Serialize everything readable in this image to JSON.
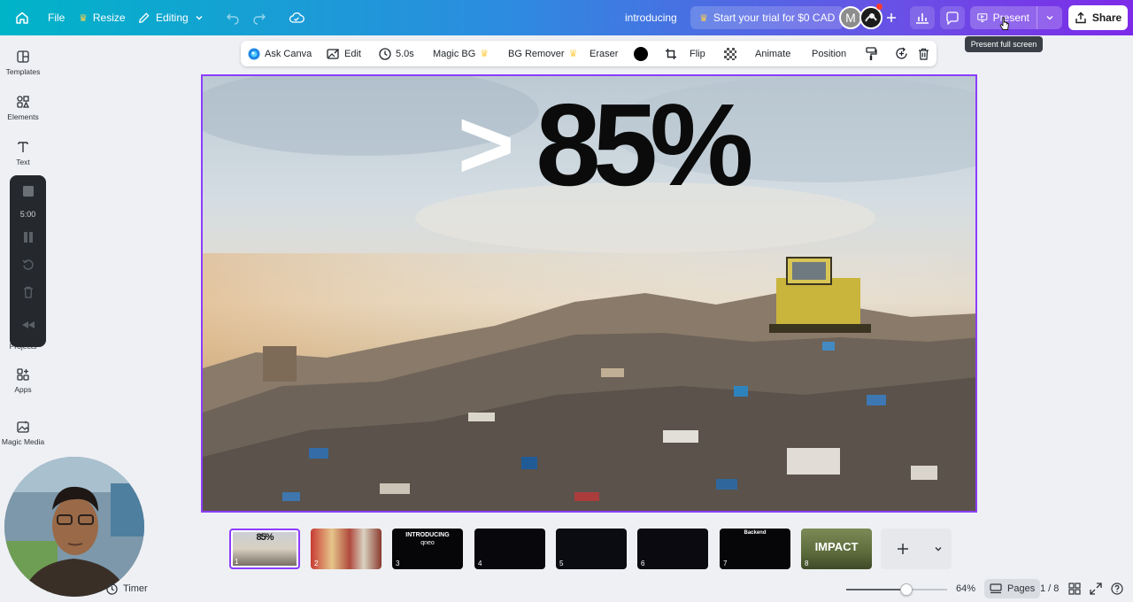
{
  "topbar": {
    "home_icon": "home-icon",
    "file_label": "File",
    "resize_label": "Resize",
    "editing_label": "Editing",
    "doc_title": "introducing",
    "trial_label": "Start your trial for $0 CAD",
    "avatar_initial": "M",
    "present_label": "Present",
    "share_label": "Share",
    "tooltip": "Present full screen"
  },
  "sidebar": {
    "items": [
      {
        "label": "Templates",
        "icon": "templates-icon"
      },
      {
        "label": "Elements",
        "icon": "elements-icon"
      },
      {
        "label": "Text",
        "icon": "text-icon"
      },
      {
        "label": "Projects",
        "icon": "projects-icon"
      },
      {
        "label": "Apps",
        "icon": "apps-icon"
      },
      {
        "label": "Magic Media",
        "icon": "magic-media-icon"
      }
    ]
  },
  "timer_panel": {
    "time": "5:00"
  },
  "context_toolbar": {
    "ask_canva": "Ask Canva",
    "edit": "Edit",
    "duration": "5.0s",
    "magic_bg": "Magic BG",
    "bg_remover": "BG Remover",
    "eraser": "Eraser",
    "flip": "Flip",
    "animate": "Animate",
    "position": "Position"
  },
  "slide": {
    "prefix": ">",
    "headline": "85%"
  },
  "thumbnails": [
    {
      "num": "1",
      "text": "85%",
      "selected": true
    },
    {
      "num": "2",
      "text": ""
    },
    {
      "num": "3",
      "text": "INTRODUCING",
      "sub": "qneo"
    },
    {
      "num": "4",
      "text": ""
    },
    {
      "num": "5",
      "text": ""
    },
    {
      "num": "6",
      "text": ""
    },
    {
      "num": "7",
      "text": "Backend"
    },
    {
      "num": "8",
      "text": "IMPACT"
    }
  ],
  "bottom_bar": {
    "timer_label": "Timer",
    "zoom_value": 64,
    "zoom_label": "64%",
    "pages_label": "Pages",
    "page_counter": "1 / 8"
  },
  "colors": {
    "accent": "#8b3dff",
    "topbar_start": "#00b4c8",
    "topbar_end": "#7d2ae8"
  }
}
